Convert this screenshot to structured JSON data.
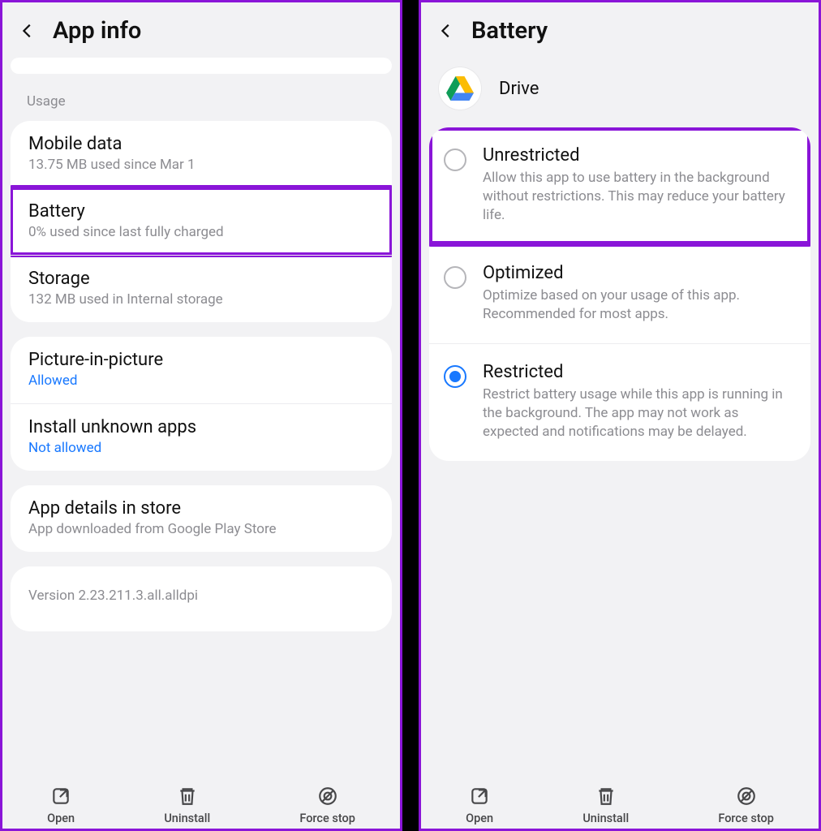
{
  "left": {
    "title": "App info",
    "section_label": "Usage",
    "rows": {
      "mobile_data": {
        "title": "Mobile data",
        "sub": "13.75 MB used since Mar 1"
      },
      "battery": {
        "title": "Battery",
        "sub": "0% used since last fully charged"
      },
      "storage": {
        "title": "Storage",
        "sub": "132 MB used in Internal storage"
      },
      "pip": {
        "title": "Picture-in-picture",
        "sub": "Allowed"
      },
      "install_unknown": {
        "title": "Install unknown apps",
        "sub": "Not allowed"
      },
      "app_details": {
        "title": "App details in store",
        "sub": "App downloaded from Google Play Store"
      }
    },
    "version": "Version 2.23.211.3.all.alldpi"
  },
  "right": {
    "title": "Battery",
    "app_name": "Drive",
    "options": {
      "unrestricted": {
        "title": "Unrestricted",
        "desc": "Allow this app to use battery in the background without restrictions. This may reduce your battery life."
      },
      "optimized": {
        "title": "Optimized",
        "desc": "Optimize based on your usage of this app. Recommended for most apps."
      },
      "restricted": {
        "title": "Restricted",
        "desc": "Restrict battery usage while this app is running in the background. The app may not work as expected and notifications may be delayed."
      }
    }
  },
  "actions": {
    "open": "Open",
    "uninstall": "Uninstall",
    "force_stop": "Force stop"
  }
}
